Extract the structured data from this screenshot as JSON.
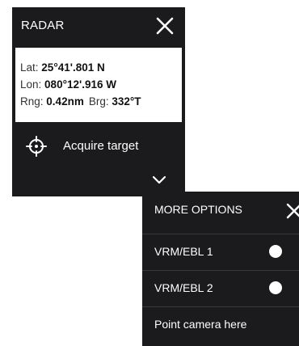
{
  "radar_panel": {
    "title": "RADAR",
    "close_icon": "close-icon",
    "info": {
      "lat_label": "Lat:",
      "lat_value": "25°41'.801 N",
      "lon_label": "Lon:",
      "lon_value": "080°12'.916 W",
      "rng_label": "Rng:",
      "rng_value": "0.42nm",
      "brg_label": "Brg:",
      "brg_value": "332°T"
    },
    "acquire": {
      "icon": "crosshair-icon",
      "label": "Acquire target"
    },
    "expand_icon": "chevron-down-icon"
  },
  "options_panel": {
    "title": "MORE OPTIONS",
    "close_icon": "close-icon",
    "items": [
      {
        "label": "VRM/EBL 1",
        "has_radio": true
      },
      {
        "label": "VRM/EBL 2",
        "has_radio": true
      },
      {
        "label": "Point camera here",
        "has_radio": false
      }
    ]
  },
  "colors": {
    "panel_background": "#1b1b1d",
    "text_primary": "#ffffff",
    "info_background": "#ffffff"
  }
}
